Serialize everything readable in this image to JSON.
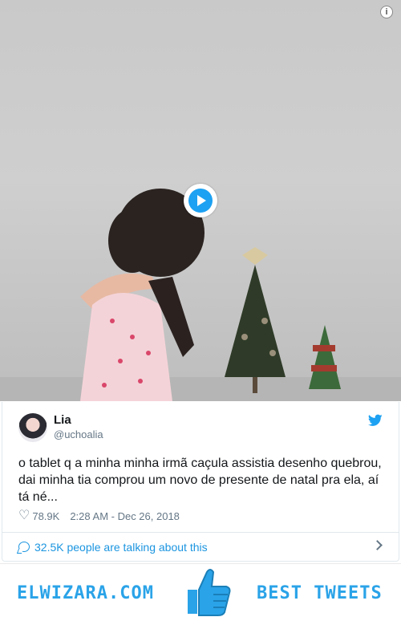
{
  "video": {
    "info_icon": "info-icon",
    "play_icon": "play-button-icon"
  },
  "tweet": {
    "author_name": "Lia",
    "author_handle": "@uchoalia",
    "text": "o tablet q a minha minha irmã caçula assistia desenho quebrou, dai minha tia comprou um novo de presente de natal pra ela, aí tá né...",
    "likes": "78.9K",
    "timestamp": "2:28 AM - Dec 26, 2018",
    "brand_color": "#1da1f2"
  },
  "conversation": {
    "label": "32.5K people are talking about this"
  },
  "footer": {
    "site": "ELWIZARA.COM",
    "tagline": "BEST TWEETS",
    "accent": "#2aa3e8"
  }
}
